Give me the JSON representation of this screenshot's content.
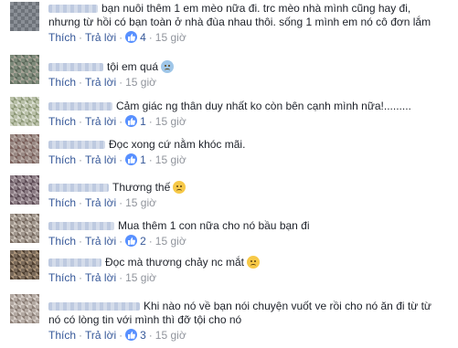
{
  "actions": {
    "like": "Thích",
    "reply": "Trả lời",
    "separator": "·"
  },
  "comments": [
    {
      "lines": [
        "bạn nuôi thêm 1 em mèo nữa đi. trc mèo nhà mình cũng hay đi,",
        "nhưng từ hồi có bạn toàn ở nhà đùa nhau thôi. sống 1 mình em nó cô đơn lắm"
      ],
      "likes": "4",
      "time": "15 giờ"
    },
    {
      "lines": [
        "tội em quá"
      ],
      "emoji": "cold-sweat-emoji",
      "likes": "",
      "time": "15 giờ"
    },
    {
      "lines": [
        "Cảm giác ng thân duy nhất ko còn bên cạnh mình nữa!........."
      ],
      "likes": "1",
      "time": "15 giờ"
    },
    {
      "lines": [
        "Đọc xong cứ nằm khóc mãi."
      ],
      "likes": "1",
      "time": "15 giờ"
    },
    {
      "lines": [
        "Thương thế"
      ],
      "emoji": "sad-face-emoji",
      "likes": "",
      "time": "15 giờ"
    },
    {
      "lines": [
        "Mua thêm 1 con nữa cho nó bầu bạn đi"
      ],
      "likes": "2",
      "time": "15 giờ"
    },
    {
      "lines": [
        "Đọc mà thương chảy nc mắt"
      ],
      "emoji": "sad-face-emoji",
      "likes": "",
      "time": "15 giờ"
    },
    {
      "lines": [
        "Khi nào nó về bạn nói chuyện vuốt ve rồi cho nó ăn đi từ từ",
        "nó có lòng tin với mình thì đỡ tội cho nó"
      ],
      "likes": "3",
      "time": "15 giờ"
    }
  ]
}
